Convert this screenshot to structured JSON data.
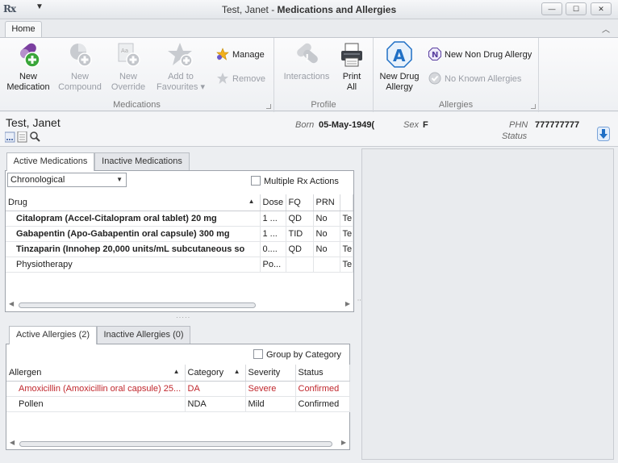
{
  "window": {
    "app_icon": "Rx",
    "qa_menu": "▼",
    "title_patient": "Test, Janet",
    "title_sep": " - ",
    "title_section": "Medications and Allergies",
    "btn_min": "—",
    "btn_max": "☐",
    "btn_close": "✕"
  },
  "ribbon": {
    "tab_home": "Home",
    "collapse": "︿",
    "groups": {
      "medications": {
        "label": "Medications",
        "new_medication": [
          "New",
          "Medication"
        ],
        "new_compound": [
          "New",
          "Compound"
        ],
        "new_override": [
          "New",
          "Override"
        ],
        "add_to_favourites": [
          "Add to",
          "Favourites ▾"
        ],
        "manage": "Manage",
        "remove": "Remove"
      },
      "profile": {
        "label": "Profile",
        "interactions": "Interactions",
        "print_all": [
          "Print",
          "All"
        ]
      },
      "allergies": {
        "label": "Allergies",
        "new_drug_allergy": [
          "New Drug",
          "Allergy"
        ],
        "new_non_drug_allergy": "New Non Drug Allergy",
        "no_known_allergies": "No Known Allergies"
      }
    }
  },
  "patient": {
    "name": "Test, Janet",
    "born_label": "Born",
    "born_value": "05-May-1949(",
    "sex_label": "Sex",
    "sex_value": "F",
    "phn_label": "PHN",
    "phn_value": "777777777",
    "status_label": "Status",
    "status_value": ""
  },
  "medications": {
    "tabs": [
      "Active Medications",
      "Inactive Medications"
    ],
    "sort_select": "Chronological",
    "multiple_rx_label": "Multiple Rx Actions",
    "columns": [
      "Drug",
      "Dose",
      "FQ",
      "PRN",
      ""
    ],
    "rows": [
      {
        "drug": "Citalopram (Accel-Citalopram oral tablet) 20 mg",
        "dose": "1 ...",
        "fq": "QD",
        "prn": "No",
        "extra": "Te",
        "bold": true
      },
      {
        "drug": "Gabapentin (Apo-Gabapentin oral capsule) 300 mg",
        "dose": "1 ...",
        "fq": "TID",
        "prn": "No",
        "extra": "Te",
        "bold": true
      },
      {
        "drug": "Tinzaparin (Innohep 20,000 units/mL subcutaneous so",
        "dose": "0....",
        "fq": "QD",
        "prn": "No",
        "extra": "Te",
        "bold": true
      },
      {
        "drug": "Physiotherapy",
        "dose": "Po...",
        "fq": "",
        "prn": "",
        "extra": "Te",
        "bold": false
      }
    ]
  },
  "allergies": {
    "tabs": [
      "Active Allergies (2)",
      "Inactive Allergies (0)"
    ],
    "group_by_label": "Group by Category",
    "columns": [
      "Allergen",
      "Category",
      "Severity",
      "Status"
    ],
    "rows": [
      {
        "allergen": "Amoxicillin (Amoxicillin oral capsule) 25...",
        "category": "DA",
        "severity": "Severe",
        "status": "Confirmed",
        "color": "#c0272d"
      },
      {
        "allergen": "Pollen",
        "category": "NDA",
        "severity": "Mild",
        "status": "Confirmed",
        "color": "#222222"
      }
    ]
  },
  "colors": {
    "accent_blue": "#1f6fc5",
    "allergy_red": "#c0272d",
    "new_med_purple": "#7b3fa0",
    "new_med_green": "#3aa63a"
  }
}
